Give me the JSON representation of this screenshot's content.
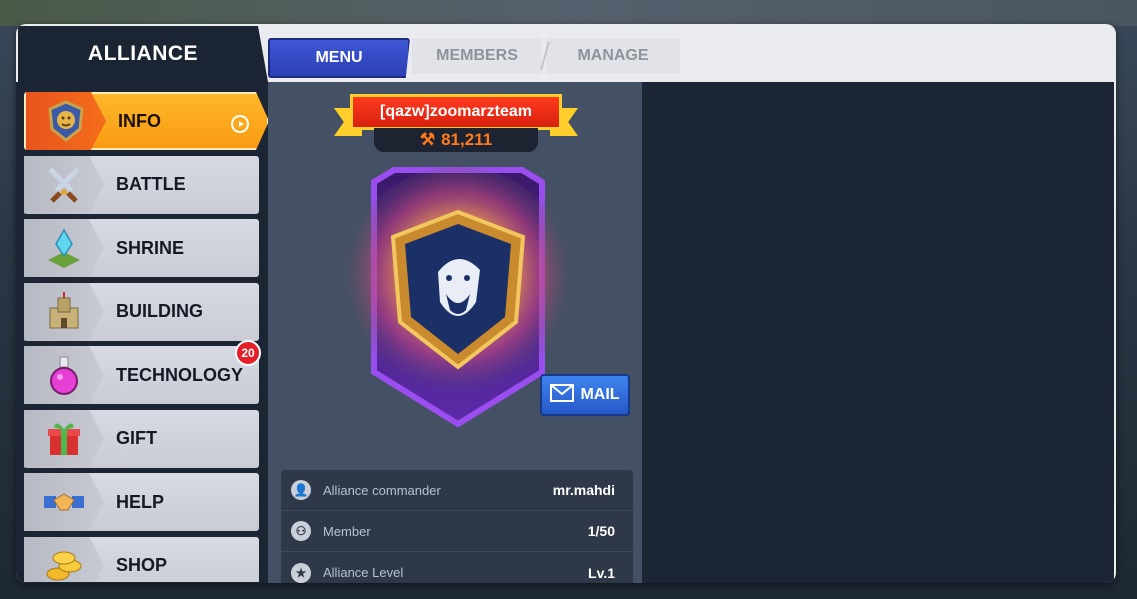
{
  "header": {
    "title": "ALLIANCE"
  },
  "tabs": [
    {
      "label": "MENU",
      "active": true
    },
    {
      "label": "MEMBERS",
      "active": false
    },
    {
      "label": "MANAGE",
      "active": false
    }
  ],
  "sidebar": {
    "items": [
      {
        "label": "INFO",
        "icon": "lion-crest-icon",
        "active": true
      },
      {
        "label": "BATTLE",
        "icon": "crossed-swords-icon"
      },
      {
        "label": "SHRINE",
        "icon": "crystal-shrine-icon"
      },
      {
        "label": "BUILDING",
        "icon": "castle-icon"
      },
      {
        "label": "TECHNOLOGY",
        "icon": "potion-flask-icon",
        "badge": "20"
      },
      {
        "label": "GIFT",
        "icon": "gift-box-icon"
      },
      {
        "label": "HELP",
        "icon": "handshake-icon"
      },
      {
        "label": "SHOP",
        "icon": "gold-coins-icon"
      }
    ]
  },
  "alliance": {
    "name": "[qazw]zoomarzteam",
    "power": "81,211",
    "emblem_icon": "gorilla-shield-icon",
    "mail_label": "MAIL"
  },
  "info_rows": [
    {
      "icon": "commander-icon",
      "label": "Alliance commander",
      "value": "mr.mahdi"
    },
    {
      "icon": "members-icon",
      "label": "Member",
      "value": "1/50"
    },
    {
      "icon": "star-level-icon",
      "label": "Alliance Level",
      "value": "Lv.1"
    }
  ],
  "colors": {
    "accent_orange": "#f99b12",
    "tab_blue": "#3d57d6",
    "panel_dark": "#1c2534",
    "ribbon_red": "#e2260f",
    "power_orange": "#ff7a1a",
    "badge_red": "#e3202a"
  }
}
